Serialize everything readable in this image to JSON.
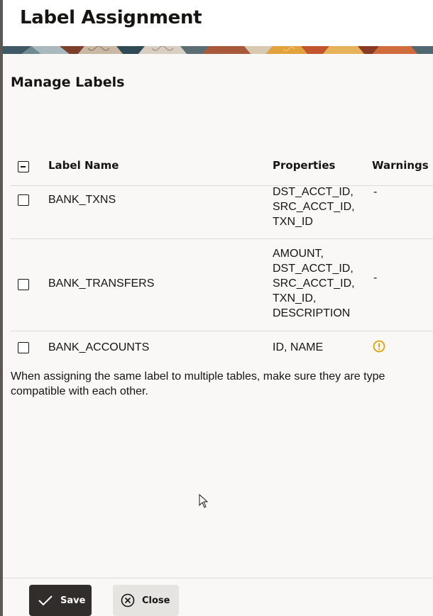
{
  "dialog": {
    "title": "Label Assignment",
    "section_title": "Manage Labels"
  },
  "table": {
    "headers": {
      "label_name": "Label Name",
      "properties": "Properties",
      "warnings": "Warnings"
    },
    "select_all_state": "indeterminate",
    "rows": [
      {
        "label": "BANK_TXNS",
        "properties": "DST_ACCT_ID,\nSRC_ACCT_ID,\nTXN_ID",
        "warning": "-",
        "checked": false
      },
      {
        "label": "BANK_TRANSFERS",
        "properties": "AMOUNT,\nDST_ACCT_ID,\nSRC_ACCT_ID,\nTXN_ID,\nDESCRIPTION",
        "warning": "-",
        "checked": false
      },
      {
        "label": "BANK_ACCOUNTS",
        "properties": "ID, NAME",
        "warning_icon": "warning-icon",
        "checked": false
      }
    ]
  },
  "note": "When assigning the same label to multiple tables, make sure they are type compatible with each other.",
  "footer": {
    "save_label": "Save",
    "close_label": "Close"
  },
  "colors": {
    "primary_button": "#312d2a",
    "secondary_button": "#e6e4e1",
    "warning": "#e2a200"
  }
}
